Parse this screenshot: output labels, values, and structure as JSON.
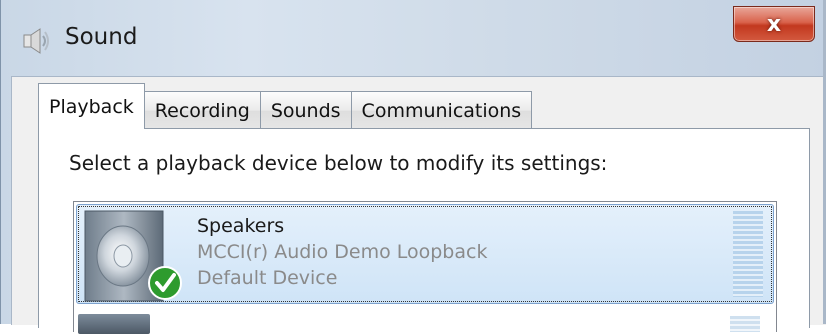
{
  "window": {
    "title": "Sound",
    "icon": "speaker-icon",
    "close_label": "x"
  },
  "tabs": [
    {
      "label": "Playback",
      "active": true
    },
    {
      "label": "Recording",
      "active": false
    },
    {
      "label": "Sounds",
      "active": false
    },
    {
      "label": "Communications",
      "active": false
    }
  ],
  "instruction": "Select a playback device below to modify its settings:",
  "devices": [
    {
      "name": "Speakers",
      "description": "MCCI(r) Audio Demo Loopback",
      "status": "Default Device",
      "icon": "speaker-icon",
      "badge": "default-check-icon",
      "selected": true
    }
  ],
  "colors": {
    "selection": "#cfe4f7",
    "close_button": "#c2381f",
    "check_badge": "#2e9b2e"
  }
}
